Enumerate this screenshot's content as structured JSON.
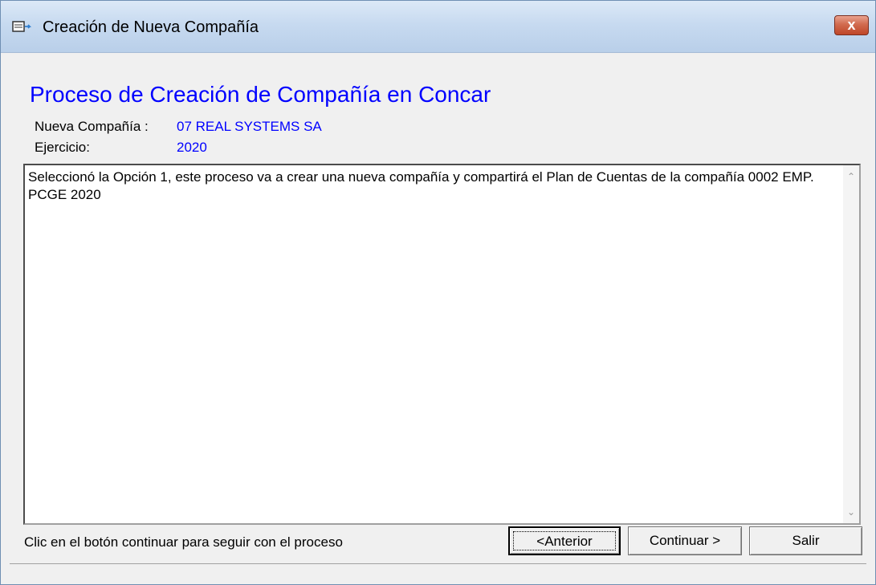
{
  "window": {
    "title": "Creación de Nueva Compañía",
    "close_label": "x"
  },
  "header": {
    "heading": "Proceso de Creación de Compañía en Concar",
    "company_label": "Nueva Compañía :",
    "company_value": "07 REAL SYSTEMS SA",
    "year_label": "Ejercicio:",
    "year_value": "2020"
  },
  "memo": {
    "text": "Seleccionó la Opción 1, este proceso va a crear una nueva compañía y compartirá el Plan de Cuentas de la compañía 0002 EMP. PCGE 2020"
  },
  "footer": {
    "hint": "Clic en el botón continuar para seguir con el proceso",
    "prev_button": "<Anterior",
    "next_button": "Continuar >",
    "exit_button": "Salir"
  },
  "icons": {
    "window_icon": "application-icon",
    "close": "close-icon",
    "scroll_up": "chevron-up-icon",
    "scroll_down": "chevron-down-icon"
  },
  "colors": {
    "accent_text": "#0000ff",
    "titlebar": "#c7daf0",
    "close_button": "#c94d31"
  }
}
